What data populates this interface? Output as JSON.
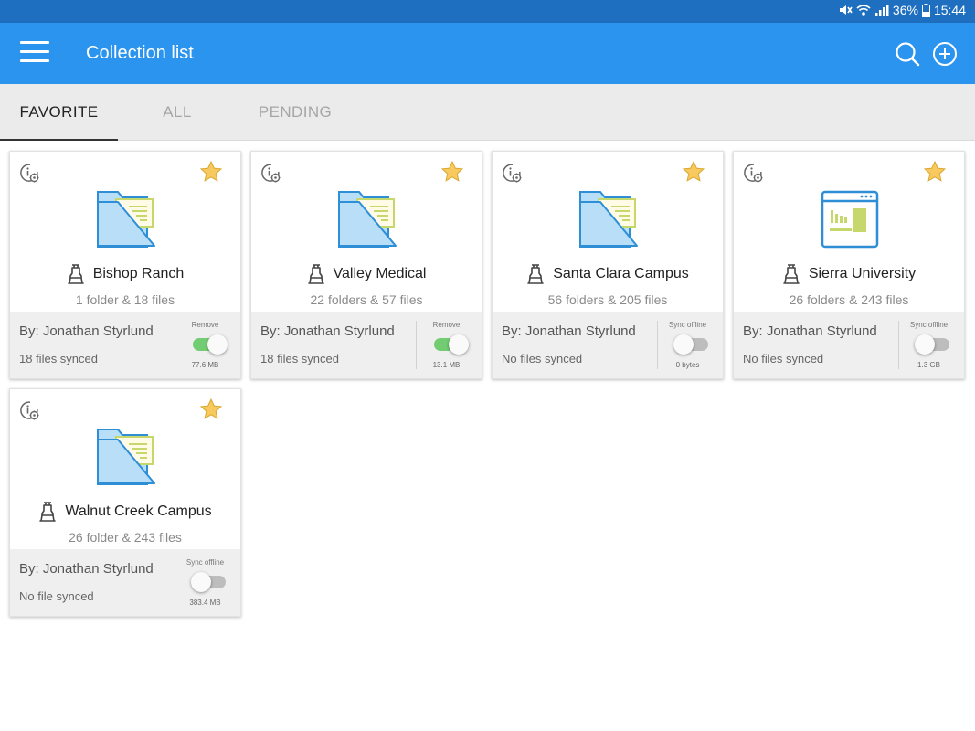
{
  "status_bar": {
    "battery": "36%",
    "time": "15:44",
    "icons": [
      "mute-icon",
      "wifi-icon",
      "signal-icon",
      "battery-icon"
    ]
  },
  "app_bar": {
    "title": "Collection list",
    "color": "#2b94ee",
    "icons": [
      "menu-icon",
      "search-icon",
      "add-circle-icon"
    ]
  },
  "tabs": [
    {
      "label": "FAVORITE",
      "active": true
    },
    {
      "label": "ALL",
      "active": false
    },
    {
      "label": "PENDING",
      "active": false
    }
  ],
  "cards": [
    {
      "title": "Bishop Ranch",
      "subtitle": "1 folder & 18 files",
      "by": "By: Jonathan Styrlund",
      "sync_status": "18 files synced",
      "toggle_label": "Remove",
      "toggle_on": true,
      "size": "77.6 MB",
      "icon": "folder-icon",
      "favorite": true
    },
    {
      "title": "Valley Medical",
      "subtitle": "22 folders & 57 files",
      "by": "By: Jonathan Styrlund",
      "sync_status": "18 files synced",
      "toggle_label": "Remove",
      "toggle_on": true,
      "size": "13.1 MB",
      "icon": "folder-icon",
      "favorite": true
    },
    {
      "title": "Santa Clara Campus",
      "subtitle": "56 folders & 205 files",
      "by": "By: Jonathan Styrlund",
      "sync_status": "No files synced",
      "toggle_label": "Sync offline",
      "toggle_on": false,
      "size": "0 bytes",
      "icon": "folder-icon",
      "favorite": true
    },
    {
      "title": "Sierra University",
      "subtitle": "26 folders & 243 files",
      "by": "By: Jonathan Styrlund",
      "sync_status": "No files synced",
      "toggle_label": "Sync offline",
      "toggle_on": false,
      "size": "1.3 GB",
      "icon": "dashboard-window-icon",
      "favorite": true
    },
    {
      "title": "Walnut Creek Campus",
      "subtitle": "26 folder & 243 files",
      "by": "By: Jonathan Styrlund",
      "sync_status": "No file synced",
      "toggle_label": "Sync offline",
      "toggle_on": false,
      "size": "383.4 MB",
      "icon": "folder-icon",
      "favorite": true
    }
  ],
  "colors": {
    "toggle_on": "#72cd72",
    "toggle_off": "#bdbdbd",
    "star": "#f7c95e",
    "folder_fill": "#b9def8",
    "folder_stroke": "#2e8ed6",
    "paper_lines": "#c6d86b"
  }
}
